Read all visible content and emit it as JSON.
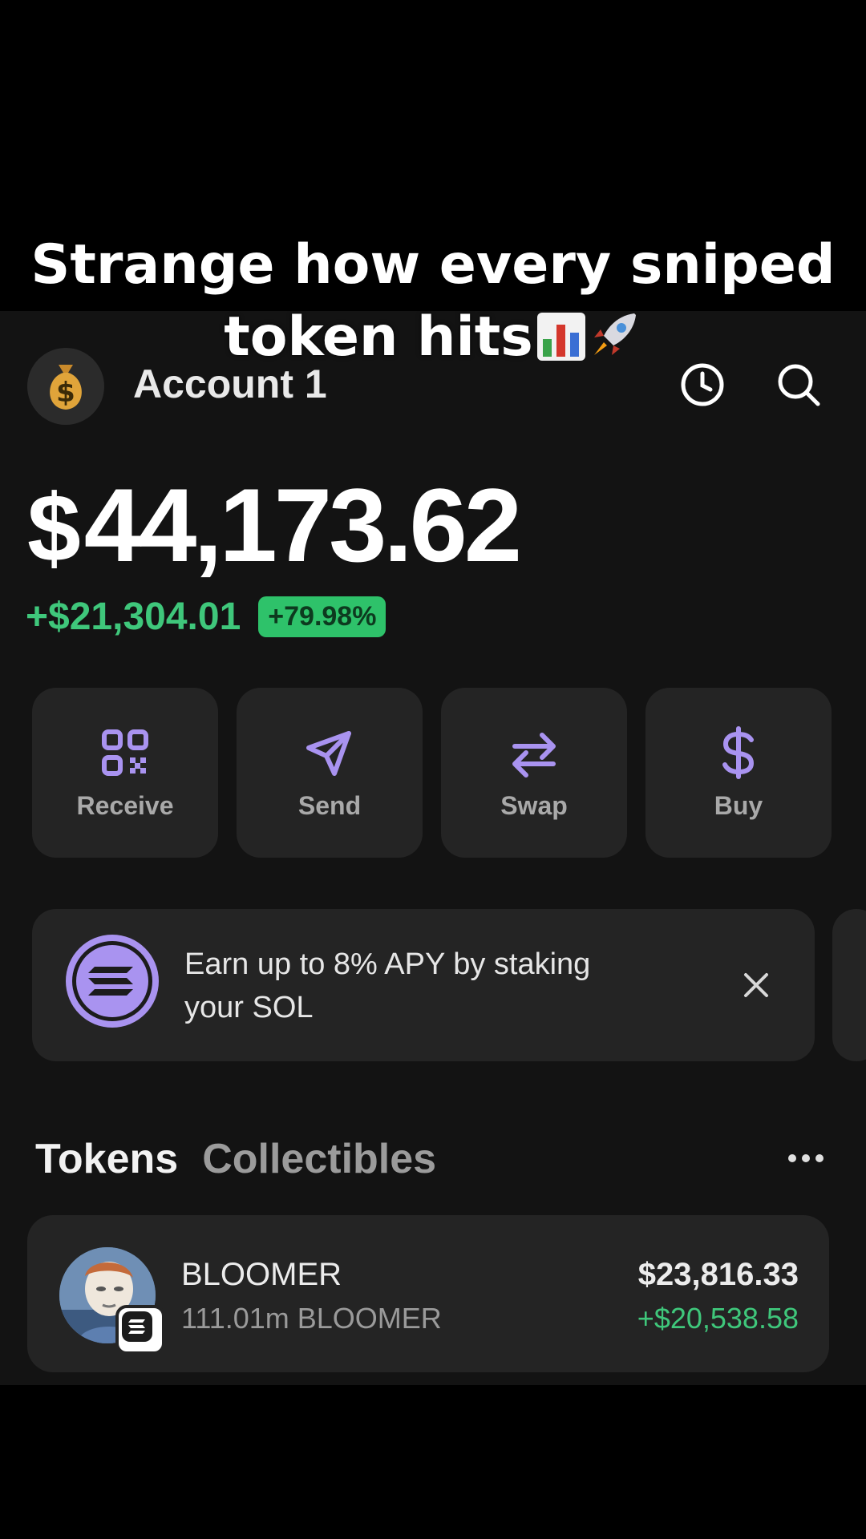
{
  "caption": {
    "line1": "Strange how every sniped",
    "line2": "token hits"
  },
  "header": {
    "account_name": "Account 1",
    "avatar_icon": "money-bag-icon",
    "history_icon": "clock-icon",
    "search_icon": "search-icon"
  },
  "balance": {
    "currency_symbol": "$",
    "amount": "44,173.62",
    "change_amount": "+$21,304.01",
    "change_percent": "+79.98%"
  },
  "actions": [
    {
      "label": "Receive",
      "icon": "qr-code-icon"
    },
    {
      "label": "Send",
      "icon": "send-icon"
    },
    {
      "label": "Swap",
      "icon": "swap-icon"
    },
    {
      "label": "Buy",
      "icon": "dollar-icon"
    }
  ],
  "banner": {
    "text_line1": "Earn up to 8% APY by staking",
    "text_line2": "your SOL",
    "icon": "solana-icon"
  },
  "tabs": {
    "tokens": "Tokens",
    "collectibles": "Collectibles"
  },
  "tokens": [
    {
      "name": "BLOOMER",
      "amount": "111.01m BLOOMER",
      "value": "$23,816.33",
      "pnl": "+$20,538.58"
    }
  ],
  "colors": {
    "background": "#131313",
    "card": "#242424",
    "accent_purple": "#a993f0",
    "positive_green": "#3fc77b"
  }
}
